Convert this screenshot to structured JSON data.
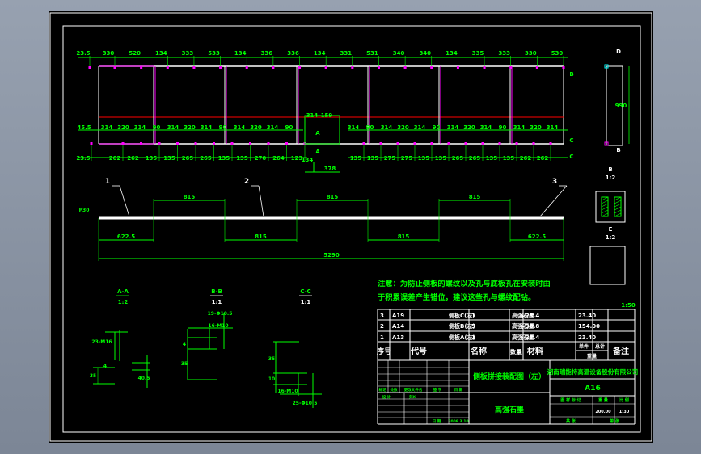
{
  "colors": {
    "background": "#000000",
    "dimension": "#00ff00",
    "outline": "#ffffff",
    "hole": "#ff00ff",
    "centerline": "#ff0000",
    "viewport": "#8a94a4"
  },
  "plan_view": {
    "top_dims": [
      "23.5",
      "330",
      "520",
      "134",
      "333",
      "533",
      "134",
      "336",
      "336",
      "134",
      "331",
      "531",
      "340",
      "340",
      "134",
      "335",
      "333",
      "330",
      "530"
    ],
    "mid_dims": [
      "45.5",
      "314",
      "320",
      "314",
      "90",
      "314",
      "320",
      "314",
      "90",
      "314",
      "320",
      "314",
      "90"
    ],
    "mid_dims_right": [
      "314",
      "90",
      "314",
      "320",
      "314",
      "90",
      "314",
      "320",
      "314",
      "90",
      "314",
      "320",
      "314"
    ],
    "bot_dims": [
      "23.5",
      "262",
      "262",
      "135",
      "135",
      "265",
      "265",
      "135",
      "135",
      "270",
      "264",
      "123"
    ],
    "bot_dims_right": [
      "135",
      "135",
      "275",
      "275",
      "135",
      "135",
      "265",
      "265",
      "135",
      "135",
      "262",
      "262"
    ],
    "center_dims": [
      "314",
      "159",
      "134",
      "378"
    ],
    "detail_marks": [
      "A",
      "A"
    ],
    "section_marks": [
      "B",
      "B",
      "C",
      "C"
    ]
  },
  "elevation_view": {
    "leaders": [
      "1",
      "2",
      "3"
    ],
    "dims_top": [
      "815",
      "815",
      "815"
    ],
    "dims_bottom": [
      "622.5",
      "815",
      "815",
      "622.5"
    ],
    "overall": "5290",
    "left_label": "P30"
  },
  "right_views": {
    "side_dim": "990",
    "side_marks": [
      "D",
      "B"
    ],
    "view_b_title": "B",
    "view_b_scale": "1:2",
    "view_e_title": "E",
    "view_e_scale": "1:2"
  },
  "sections": [
    {
      "title": "A-A",
      "scale": "1:2",
      "labels": [
        "4",
        "23-M16",
        "35",
        "40.5"
      ]
    },
    {
      "title": "B-B",
      "scale": "1:1",
      "labels": [
        "19-Φ10.5",
        "16-M10",
        "4",
        "35"
      ]
    },
    {
      "title": "C-C",
      "scale": "1:1",
      "labels": [
        "35",
        "10",
        "16-M10",
        "25-Φ10.5"
      ]
    }
  ],
  "note": {
    "line1": "注意：为防止侧板的螺纹以及孔与底板孔在安装时由",
    "line2": "于积累误差产生错位，建议这些孔与螺纹配钻。",
    "scale": "1:50"
  },
  "bom": {
    "rows": [
      {
        "no": "3",
        "code": "A19",
        "name": "侧板C(左)",
        "qty": "1",
        "material": "高强石墨",
        "unit": "23.4",
        "total": "23.40",
        "remark": ""
      },
      {
        "no": "2",
        "code": "A14",
        "name": "侧板B(左)",
        "qty": "5",
        "material": "高强石墨",
        "unit": "30.8",
        "total": "154.00",
        "remark": ""
      },
      {
        "no": "1",
        "code": "A13",
        "name": "侧板A(左)",
        "qty": "1",
        "material": "高强石墨",
        "unit": "23.4",
        "total": "23.40",
        "remark": ""
      }
    ],
    "headers": {
      "no": "序号",
      "code": "代号",
      "name": "名称",
      "qty": "数量",
      "material": "材料",
      "unit": "单件",
      "total": "总计",
      "weight": "重量",
      "remark": "备注"
    }
  },
  "title_block": {
    "drawing_title": "侧板拼接装配图（左）",
    "material": "高强石墨",
    "company": "湖南瑞能特高温设备股份有限公司",
    "drawing_no": "A16",
    "left_labels": [
      "标记",
      "处数",
      "更改文件名",
      "签 字",
      "日 期"
    ],
    "designer_labels": [
      "设 计",
      "刘X"
    ],
    "date_label": "日 期",
    "date": "2009.3.10",
    "mark_label": "图 样 标 记",
    "weight_label": "重 量",
    "scale_label": "比 例",
    "weight": "200.00",
    "scale": "1:30",
    "sheets_label": "共   张",
    "sheet_label": "第   张"
  }
}
